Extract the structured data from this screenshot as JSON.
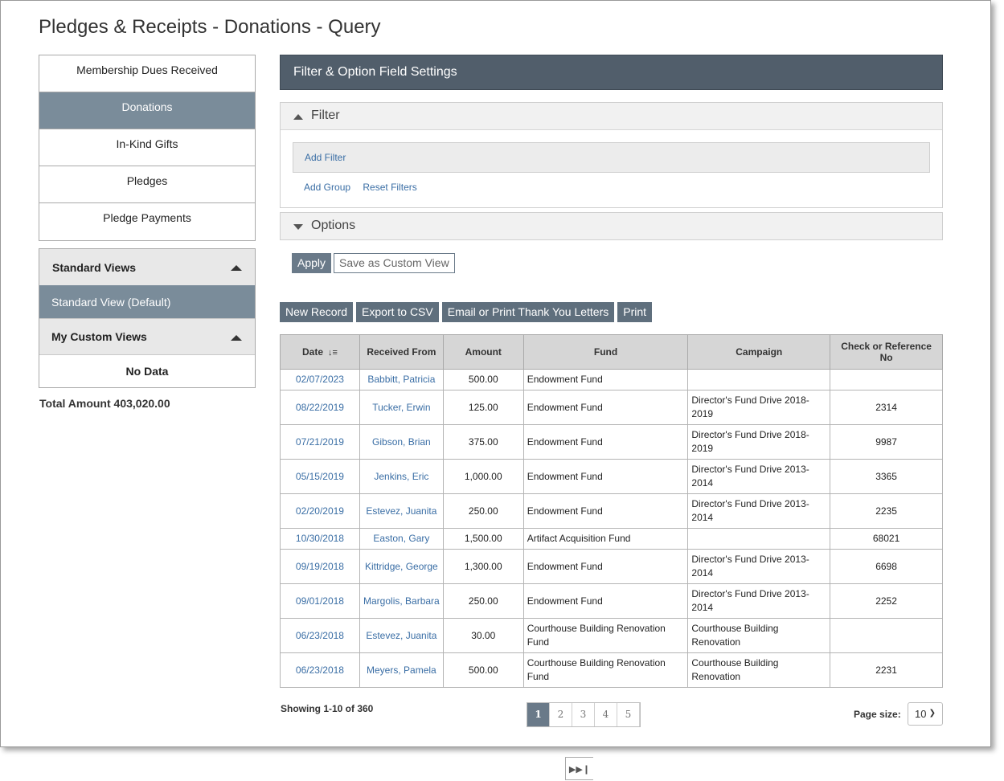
{
  "page_title": "Pledges & Receipts - Donations - Query",
  "nav": {
    "items": [
      {
        "label": "Membership Dues Received",
        "active": false
      },
      {
        "label": "Donations",
        "active": true
      },
      {
        "label": "In-Kind Gifts",
        "active": false
      },
      {
        "label": "Pledges",
        "active": false
      },
      {
        "label": "Pledge Payments",
        "active": false
      }
    ]
  },
  "views": {
    "standard_header": "Standard Views",
    "standard_item": "Standard View (Default)",
    "custom_header": "My Custom Views",
    "no_data": "No Data"
  },
  "total_label": "Total Amount 403,020.00",
  "settings": {
    "title": "Filter & Option Field Settings",
    "filter_label": "Filter",
    "add_filter": "Add Filter",
    "add_group": "Add Group",
    "reset_filters": "Reset Filters",
    "options_label": "Options",
    "apply": "Apply",
    "save_custom": "Save as Custom View"
  },
  "toolbar": {
    "new_record": "New Record",
    "export_csv": "Export to CSV",
    "email_print": "Email or Print Thank You Letters",
    "print": "Print"
  },
  "table": {
    "columns": [
      "Date",
      "Received From",
      "Amount",
      "Fund",
      "Campaign",
      "Check or Reference No"
    ],
    "rows": [
      {
        "date": "02/07/2023",
        "from": "Babbitt, Patricia",
        "amount": "500.00",
        "fund": "Endowment Fund",
        "campaign": "",
        "ref": ""
      },
      {
        "date": "08/22/2019",
        "from": "Tucker, Erwin",
        "amount": "125.00",
        "fund": "Endowment Fund",
        "campaign": "Director's Fund Drive 2018-2019",
        "ref": "2314"
      },
      {
        "date": "07/21/2019",
        "from": "Gibson, Brian",
        "amount": "375.00",
        "fund": "Endowment Fund",
        "campaign": "Director's Fund Drive 2018-2019",
        "ref": "9987"
      },
      {
        "date": "05/15/2019",
        "from": "Jenkins, Eric",
        "amount": "1,000.00",
        "fund": "Endowment Fund",
        "campaign": "Director's Fund Drive 2013-2014",
        "ref": "3365"
      },
      {
        "date": "02/20/2019",
        "from": "Estevez, Juanita",
        "amount": "250.00",
        "fund": "Endowment Fund",
        "campaign": "Director's Fund Drive 2013-2014",
        "ref": "2235"
      },
      {
        "date": "10/30/2018",
        "from": "Easton, Gary",
        "amount": "1,500.00",
        "fund": "Artifact Acquisition Fund",
        "campaign": "",
        "ref": "68021"
      },
      {
        "date": "09/19/2018",
        "from": "Kittridge, George",
        "amount": "1,300.00",
        "fund": "Endowment Fund",
        "campaign": "Director's Fund Drive 2013-2014",
        "ref": "6698"
      },
      {
        "date": "09/01/2018",
        "from": "Margolis, Barbara",
        "amount": "250.00",
        "fund": "Endowment Fund",
        "campaign": "Director's Fund Drive 2013-2014",
        "ref": "2252"
      },
      {
        "date": "06/23/2018",
        "from": "Estevez, Juanita",
        "amount": "30.00",
        "fund": "Courthouse Building Renovation Fund",
        "campaign": "Courthouse Building Renovation",
        "ref": ""
      },
      {
        "date": "06/23/2018",
        "from": "Meyers, Pamela",
        "amount": "500.00",
        "fund": "Courthouse Building Renovation Fund",
        "campaign": "Courthouse Building Renovation",
        "ref": "2231"
      }
    ]
  },
  "footer": {
    "showing": "Showing 1-10 of 360",
    "pages": [
      "1",
      "2",
      "3",
      "4",
      "5"
    ],
    "current_page": "1",
    "page_size_label": "Page size:",
    "page_size": "10"
  },
  "colors": {
    "accent": "#6a7a89",
    "header_bar": "#515e6b",
    "link": "#3a6ea5",
    "nav_active": "#7a8c9a"
  }
}
